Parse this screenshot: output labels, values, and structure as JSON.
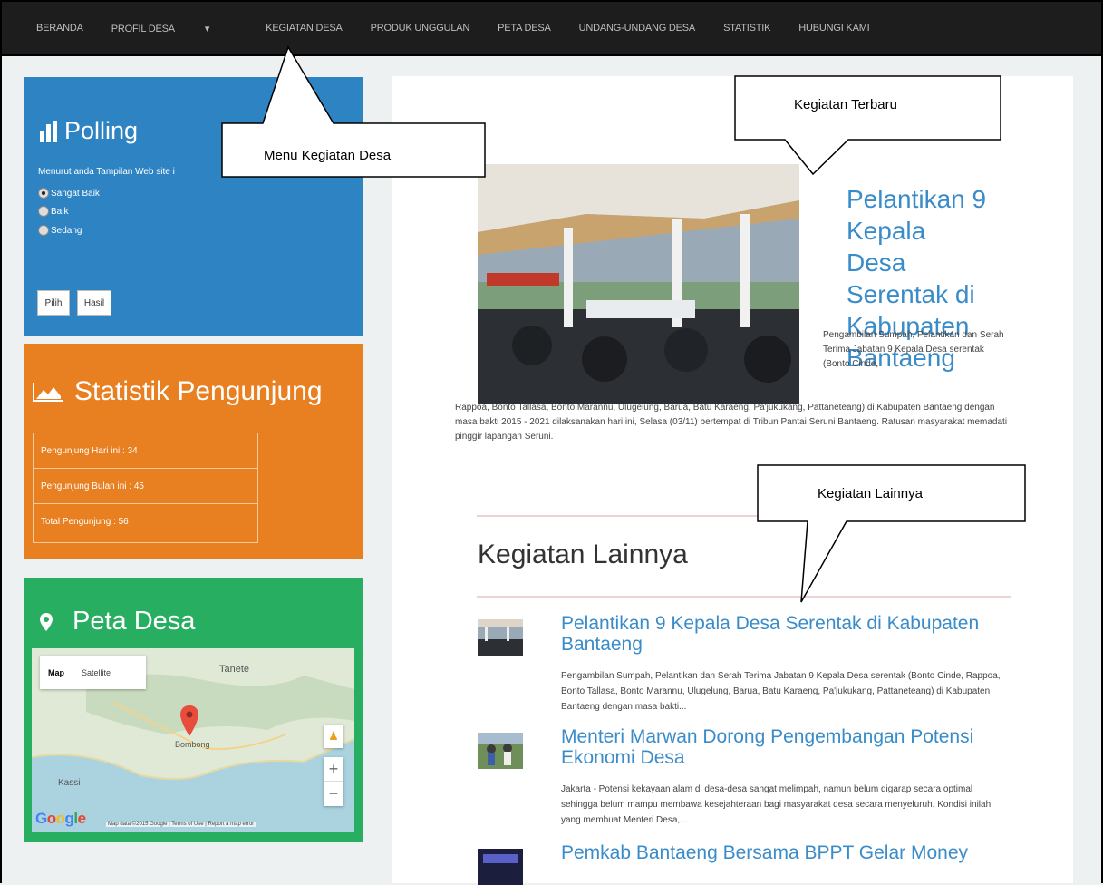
{
  "nav": {
    "items": [
      "BERANDA",
      "PROFIL DESA",
      "KEGIATAN DESA",
      "PRODUK UNGGULAN",
      "PETA DESA",
      "UNDANG-UNDANG DESA",
      "STATISTIK",
      "HUBUNGI KAMI"
    ]
  },
  "poll": {
    "title": "Polling",
    "question": "Menurut anda Tampilan Web site i",
    "options": [
      "Sangat Baik",
      "Baik",
      "Sedang"
    ],
    "selected": "Sangat Baik",
    "btn_pilih": "Pilih",
    "btn_hasil": "Hasil"
  },
  "stat": {
    "title": "Statistik Pengunjung",
    "rows": [
      "Pengunjung Hari ini : 34",
      "Pengunjung Bulan ini : 45",
      "Total Pengunjung : 56"
    ]
  },
  "peta": {
    "title": "Peta Desa",
    "map_type": [
      "Map",
      "Satellite"
    ],
    "labels": {
      "tanete": "Tanete",
      "bombong": "Bombong",
      "kassi": "Kassi"
    },
    "zoom_in": "+",
    "zoom_out": "−",
    "logo": "Google",
    "footer": "Map data ©2015 Google  |  Terms of Use  |  Report a map error"
  },
  "hero": {
    "title": "Pelantikan 9 Kepala Desa Serentak di Kabupaten Bantaeng",
    "intro": "Pengambilan Sumpah, Pelantikan dan Serah Terima Jabatan 9 Kepala Desa serentak (Bonto Cinde,",
    "body": "Rappoa, Bonto Tallasa, Bonto Marannu, Ulugelung, Barua, Batu Karaeng, Pa'jukukang, Pattaneteang) di Kabupaten Bantaeng dengan masa bakti 2015 - 2021 dilaksanakan hari ini, Selasa (03/11) bertempat di Tribun Pantai Seruni Bantaeng. Ratusan masyarakat memadati pinggir lapangan Seruni."
  },
  "lainnya": {
    "title": "Kegiatan Lainnya",
    "items": [
      {
        "title": "Pelantikan 9 Kepala Desa Serentak di Kabupaten Bantaeng",
        "text": "Pengambilan Sumpah, Pelantikan dan Serah Terima Jabatan 9 Kepala Desa serentak (Bonto Cinde, Rappoa, Bonto Tallasa, Bonto Marannu, Ulugelung, Barua, Batu Karaeng, Pa'jukukang, Pattaneteang) di Kabupaten Bantaeng dengan masa bakti..."
      },
      {
        "title": "Menteri Marwan Dorong Pengembangan Potensi Ekonomi Desa",
        "text": "Jakarta - Potensi kekayaan alam di desa-desa sangat melimpah, namun belum digarap secara optimal sehingga belum mampu membawa kesejahteraan bagi masyarakat desa secara menyeluruh. Kondisi inilah yang membuat Menteri Desa,..."
      },
      {
        "title": "Pemkab Bantaeng Bersama BPPT Gelar Money",
        "text": ""
      }
    ]
  },
  "callouts": {
    "menu": "Menu Kegiatan Desa",
    "terbaru": "Kegiatan Terbaru",
    "lainnya": "Kegiatan Lainnya"
  },
  "colors": {
    "poll": "#2e84c3",
    "stat": "#e87f21",
    "peta": "#27ae60",
    "link": "#3a8cc9",
    "nav_bg": "#1d1d1d"
  }
}
